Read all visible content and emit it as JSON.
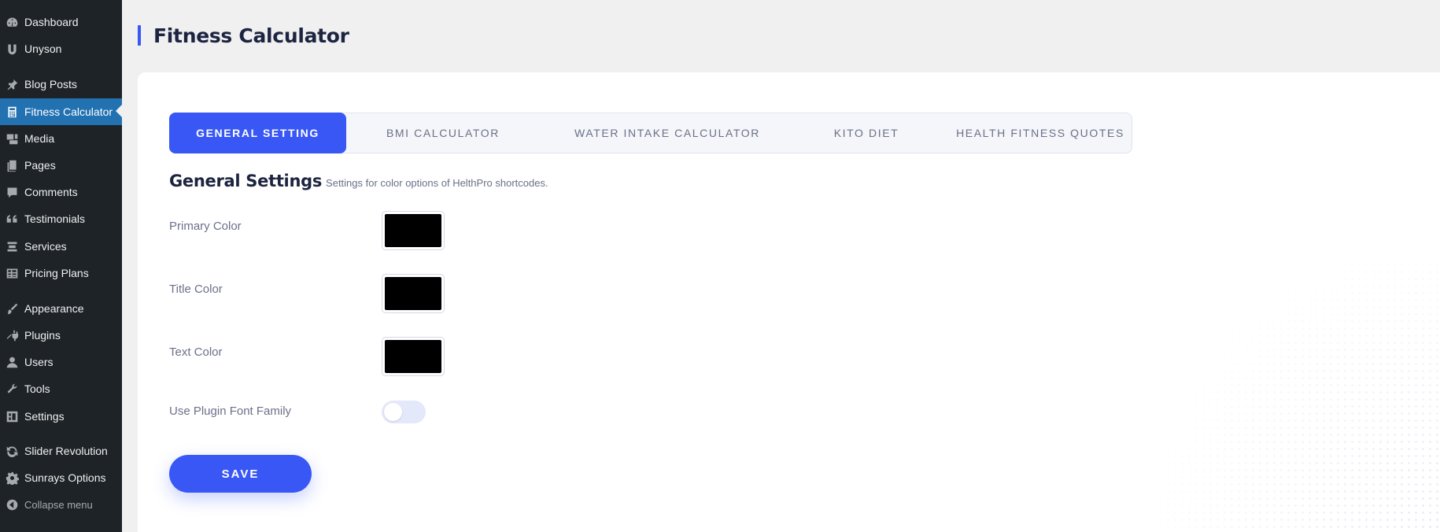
{
  "sidebar": {
    "items": [
      {
        "label": "Dashboard",
        "icon": "dashboard-icon"
      },
      {
        "label": "Unyson",
        "icon": "unyson-icon"
      },
      {
        "label": "Blog Posts",
        "icon": "pin-icon"
      },
      {
        "label": "Fitness Calculator",
        "icon": "calculator-icon",
        "active": true
      },
      {
        "label": "Media",
        "icon": "media-icon"
      },
      {
        "label": "Pages",
        "icon": "pages-icon"
      },
      {
        "label": "Comments",
        "icon": "comment-icon"
      },
      {
        "label": "Testimonials",
        "icon": "quote-icon"
      },
      {
        "label": "Services",
        "icon": "list-icon"
      },
      {
        "label": "Pricing Plans",
        "icon": "table-icon"
      },
      {
        "label": "Appearance",
        "icon": "brush-icon"
      },
      {
        "label": "Plugins",
        "icon": "plug-icon"
      },
      {
        "label": "Users",
        "icon": "user-icon"
      },
      {
        "label": "Tools",
        "icon": "wrench-icon"
      },
      {
        "label": "Settings",
        "icon": "settings-icon"
      },
      {
        "label": "Slider Revolution",
        "icon": "refresh-icon"
      },
      {
        "label": "Sunrays Options",
        "icon": "gear-icon"
      },
      {
        "label": "Collapse menu",
        "icon": "collapse-icon"
      }
    ]
  },
  "header": {
    "title": "Fitness Calculator"
  },
  "tabs": [
    {
      "label": "GENERAL SETTING",
      "active": true
    },
    {
      "label": "BMI CALCULATOR"
    },
    {
      "label": "WATER INTAKE CALCULATOR"
    },
    {
      "label": "KITO DIET"
    },
    {
      "label": "HEALTH FITNESS QUOTES"
    }
  ],
  "section": {
    "title": "General Settings",
    "subtitle": "Settings for color options of HelthPro shortcodes."
  },
  "fields": {
    "primary_color": {
      "label": "Primary Color",
      "value": "#000000"
    },
    "title_color": {
      "label": "Title Color",
      "value": "#000000"
    },
    "text_color": {
      "label": "Text Color",
      "value": "#000000"
    },
    "plugin_font": {
      "label": "Use Plugin Font Family",
      "enabled": false
    }
  },
  "save_label": "SAVE",
  "colors": {
    "accent": "#3857f5",
    "sidebar_bg": "#1d2327",
    "sidebar_active": "#2271b1",
    "heading": "#1c2440",
    "muted_text": "#6b7089"
  }
}
